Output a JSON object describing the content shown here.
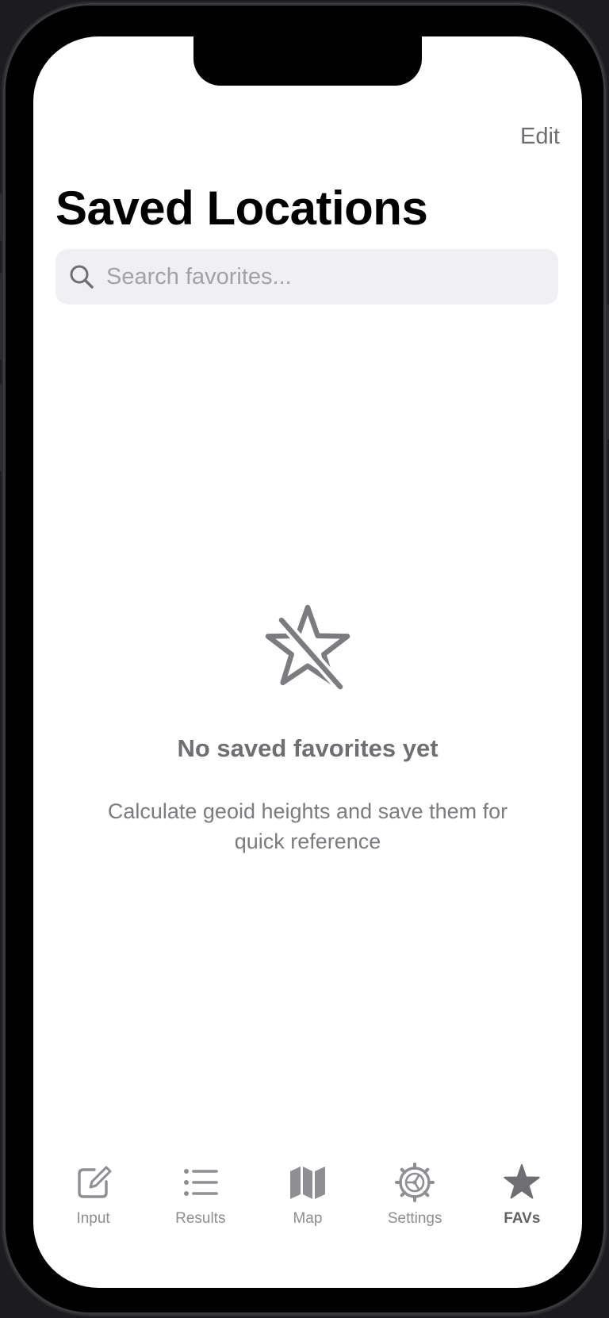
{
  "header": {
    "edit_label": "Edit",
    "title": "Saved Locations"
  },
  "search": {
    "placeholder": "Search favorites...",
    "value": "",
    "icon": "search-icon"
  },
  "empty_state": {
    "icon": "star-slash-icon",
    "title": "No saved favorites yet",
    "subtitle": "Calculate geoid heights and save them for quick reference"
  },
  "tab_bar": {
    "active": "FAVs",
    "tabs": [
      {
        "label": "Input",
        "icon": "square-pencil-icon"
      },
      {
        "label": "Results",
        "icon": "list-bullet-icon"
      },
      {
        "label": "Map",
        "icon": "map-icon"
      },
      {
        "label": "Settings",
        "icon": "gear-icon"
      },
      {
        "label": "FAVs",
        "icon": "star-fill-icon"
      }
    ]
  },
  "colors": {
    "background": "#ffffff",
    "search_field": "#efeff4",
    "secondary_text": "#6e6e73",
    "tab_inactive": "#8e8e93",
    "tab_active": "#636366"
  }
}
